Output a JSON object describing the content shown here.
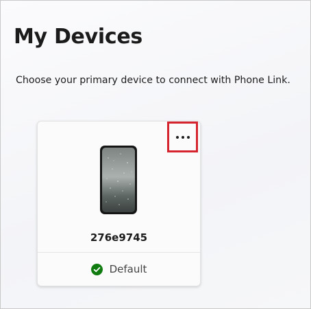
{
  "page": {
    "title": "My Devices",
    "subtitle": "Choose your primary device to connect with Phone Link."
  },
  "device": {
    "name": "276e9745",
    "status_label": "Default",
    "status_icon": "check-circle-icon",
    "more_icon": "more-options-icon"
  },
  "colors": {
    "status_green": "#107c10",
    "highlight_red": "#d6242f"
  }
}
